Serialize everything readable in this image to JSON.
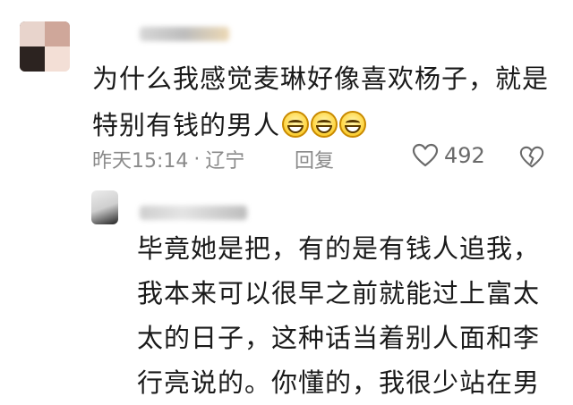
{
  "comment": {
    "text_line1": "为什么我感觉麦琳好像喜欢杨子，就是",
    "text_line2": "特别有钱的男人",
    "emoji_name": "grinning-face-icon",
    "time": "昨天15:14",
    "separator": "·",
    "location": "辽宁",
    "reply_label": "回复",
    "like_count": "492"
  },
  "reply": {
    "line1": "毕竟她是把，有的是有钱人追我，",
    "line2": "我本来可以很早之前就能过上富太",
    "line3": "太的日子，这种话当着别人面和李",
    "line4": "行亮说的。你懂的，我很少站在男"
  },
  "colors": {
    "text": "#1a1a1a",
    "meta": "#8a8a8a",
    "emoji_fill": "#ffd84a"
  }
}
